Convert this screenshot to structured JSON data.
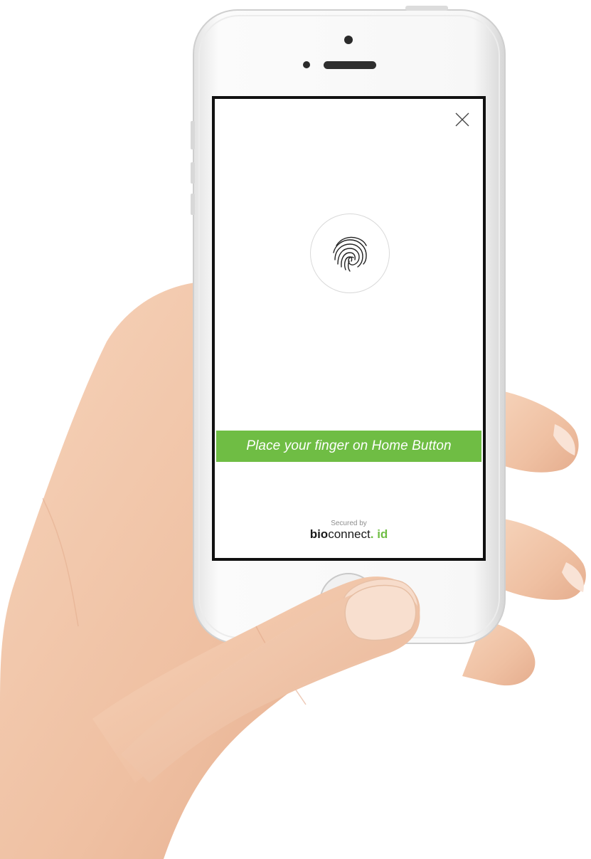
{
  "screen": {
    "close_icon": "close-icon",
    "fingerprint_icon": "fingerprint-icon",
    "prompt": "Place your finger on Home Button",
    "secured_by": "Secured by",
    "brand": {
      "bold": "bio",
      "regular": "connect",
      "dot": ".",
      "suffix": " id"
    }
  },
  "colors": {
    "accent_green": "#6fbd44",
    "phone_body": "#f4f4f4",
    "screen_border": "#111111",
    "skin": "#f2c7a8"
  }
}
